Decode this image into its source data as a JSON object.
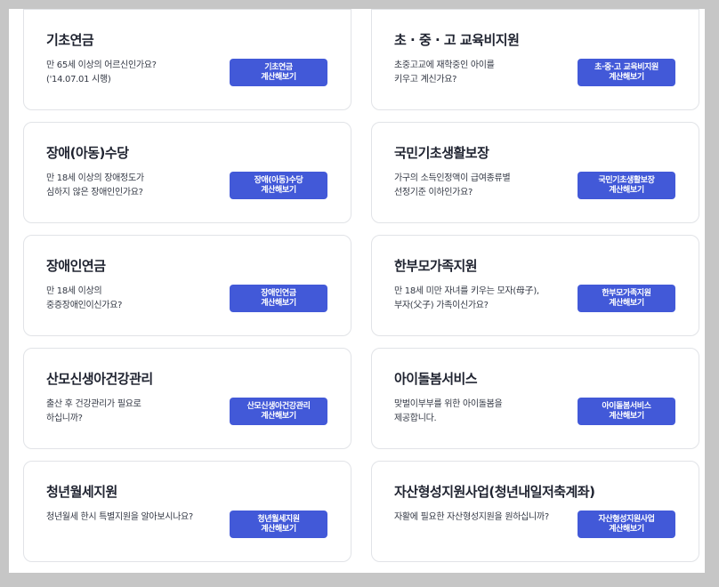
{
  "cards": [
    {
      "title": "기초연금",
      "desc1": "만 65세 이상의 어르신인가요?",
      "desc2": "('14.07.01 시행)",
      "btn1": "기초연금",
      "btn2": "계산해보기"
    },
    {
      "title": "초 · 중 · 고 교육비지원",
      "desc1": "초중고교에 재학중인 아이를",
      "desc2": "키우고 계신가요?",
      "btn1": "초·중·고 교육비지원",
      "btn2": "계산해보기"
    },
    {
      "title": "장애(아동)수당",
      "desc1": "만 18세 이상의 장애정도가",
      "desc2": "심하지 않은 장애인인가요?",
      "btn1": "장애(아동)수당",
      "btn2": "계산해보기"
    },
    {
      "title": "국민기초생활보장",
      "desc1": "가구의 소득인정액이 급여종류별",
      "desc2": "선정기준 이하인가요?",
      "btn1": "국민기초생활보장",
      "btn2": "계산해보기"
    },
    {
      "title": "장애인연금",
      "desc1": "만 18세 이상의",
      "desc2": "중증장애인이신가요?",
      "btn1": "장애인연금",
      "btn2": "계산해보기"
    },
    {
      "title": "한부모가족지원",
      "desc1": "만 18세 미만 자녀를 키우는 모자(母子),",
      "desc2": "부자(父子) 가족이신가요?",
      "btn1": "한부모가족지원",
      "btn2": "계산해보기"
    },
    {
      "title": "산모신생아건강관리",
      "desc1": "출산 후 건강관리가 필요로",
      "desc2": "하십니까?",
      "btn1": "산모신생아건강관리",
      "btn2": "계산해보기"
    },
    {
      "title": "아이돌봄서비스",
      "desc1": "맞벌이부부를 위한 아이돌봄을",
      "desc2": "제공합니다.",
      "btn1": "아이돌봄서비스",
      "btn2": "계산해보기"
    },
    {
      "title": "청년월세지원",
      "desc1": "청년월세 한시 특별지원을 알아보시나요?",
      "desc2": "",
      "btn1": "청년월세지원",
      "btn2": "계산해보기"
    },
    {
      "title": "자산형성지원사업(청년내일저축계좌)",
      "desc1": "자활에 필요한 자산형성지원을 원하십니까?",
      "desc2": "",
      "btn1": "자산형성지원사업",
      "btn2": "계산해보기"
    }
  ],
  "colors": {
    "button": "#4259d8",
    "background": "#c6c6c6",
    "card_border": "#e1e3e7"
  }
}
